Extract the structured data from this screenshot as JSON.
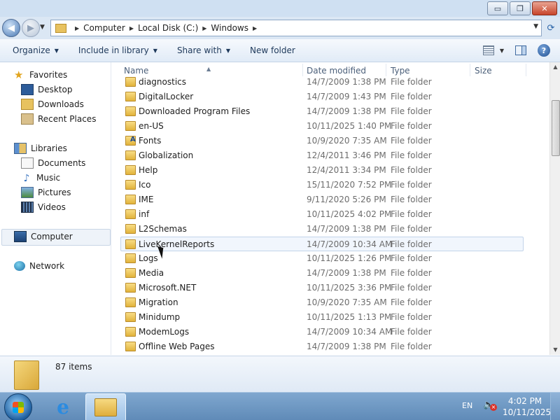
{
  "window": {
    "controls": {
      "minimize": "▭",
      "maximize": "❐",
      "close": "✕"
    }
  },
  "address": {
    "crumbs": [
      "Computer",
      "Local Disk (C:)",
      "Windows"
    ]
  },
  "toolbar": {
    "items": [
      "Organize",
      "Include in library",
      "Share with",
      "New folder"
    ]
  },
  "nav": {
    "favorites": "Favorites",
    "favorites_items": [
      "Desktop",
      "Downloads",
      "Recent Places"
    ],
    "libraries": "Libraries",
    "libraries_items": [
      "Documents",
      "Music",
      "Pictures",
      "Videos"
    ],
    "computer": "Computer",
    "network": "Network"
  },
  "columns": {
    "name": "Name",
    "date": "Date modified",
    "type": "Type",
    "size": "Size"
  },
  "files": [
    {
      "name": "diagnostics",
      "date": "14/7/2009 1:38 PM",
      "type": "File folder"
    },
    {
      "name": "DigitalLocker",
      "date": "14/7/2009 1:43 PM",
      "type": "File folder"
    },
    {
      "name": "Downloaded Program Files",
      "date": "14/7/2009 1:38 PM",
      "type": "File folder"
    },
    {
      "name": "en-US",
      "date": "10/11/2025 1:40 PM",
      "type": "File folder"
    },
    {
      "name": "Fonts",
      "date": "10/9/2020 7:35 AM",
      "type": "File folder"
    },
    {
      "name": "Globalization",
      "date": "12/4/2011 3:46 PM",
      "type": "File folder"
    },
    {
      "name": "Help",
      "date": "12/4/2011 3:34 PM",
      "type": "File folder"
    },
    {
      "name": "Ico",
      "date": "15/11/2020 7:52 PM",
      "type": "File folder"
    },
    {
      "name": "IME",
      "date": "9/11/2020 5:26 PM",
      "type": "File folder"
    },
    {
      "name": "inf",
      "date": "10/11/2025 4:02 PM",
      "type": "File folder"
    },
    {
      "name": "L2Schemas",
      "date": "14/7/2009 1:38 PM",
      "type": "File folder"
    },
    {
      "name": "LiveKernelReports",
      "date": "14/7/2009 10:34 AM",
      "type": "File folder"
    },
    {
      "name": "Logs",
      "date": "10/11/2025 1:26 PM",
      "type": "File folder"
    },
    {
      "name": "Media",
      "date": "14/7/2009 1:38 PM",
      "type": "File folder"
    },
    {
      "name": "Microsoft.NET",
      "date": "10/11/2025 3:36 PM",
      "type": "File folder"
    },
    {
      "name": "Migration",
      "date": "10/9/2020 7:35 AM",
      "type": "File folder"
    },
    {
      "name": "Minidump",
      "date": "10/11/2025 1:13 PM",
      "type": "File folder"
    },
    {
      "name": "ModemLogs",
      "date": "14/7/2009 10:34 AM",
      "type": "File folder"
    },
    {
      "name": "Offline Web Pages",
      "date": "14/7/2009 1:38 PM",
      "type": "File folder"
    }
  ],
  "status": {
    "count": "87 items"
  },
  "tray": {
    "lang": "EN",
    "time": "4:02 PM",
    "date": "10/11/2025"
  }
}
